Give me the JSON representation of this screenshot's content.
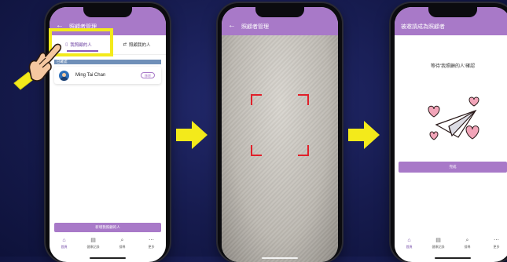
{
  "phone1": {
    "header_title": "照顧者管理",
    "tabs": [
      {
        "label": "我照顧的人",
        "icon": "clipboard-icon",
        "active": true
      },
      {
        "label": "照顧我的人",
        "icon": "heart-link-icon",
        "active": false
      }
    ],
    "section_label": "已確認",
    "contact": {
      "name": "Ming Tai Chan",
      "action_label": "移除"
    },
    "add_button_label": "新增我照顧的人",
    "nav": [
      {
        "label": "首頁",
        "icon": "home-icon",
        "active": true
      },
      {
        "label": "健康記錄",
        "icon": "clipboard-icon",
        "active": false
      },
      {
        "label": "搜尋",
        "icon": "search-icon",
        "active": false
      },
      {
        "label": "更多",
        "icon": "more-icon",
        "active": false
      }
    ]
  },
  "phone2": {
    "header_title": "照顧者管理"
  },
  "phone3": {
    "header_title": "被邀請成為照顧者",
    "waiting_text": "等待'我照顧的人'確認",
    "confirm_label": "完成",
    "nav": [
      {
        "label": "首頁",
        "icon": "home-icon",
        "active": true
      },
      {
        "label": "健康記錄",
        "icon": "clipboard-icon",
        "active": false
      },
      {
        "label": "搜尋",
        "icon": "search-icon",
        "active": false
      },
      {
        "label": "更多",
        "icon": "more-icon",
        "active": false
      }
    ]
  },
  "colors": {
    "background": "#161b4e",
    "accent": "#a879c8",
    "arrow": "#f3ea1b",
    "highlight": "#f3ea1b",
    "scan": "#e0202a",
    "heart": "#f2a5b9"
  }
}
